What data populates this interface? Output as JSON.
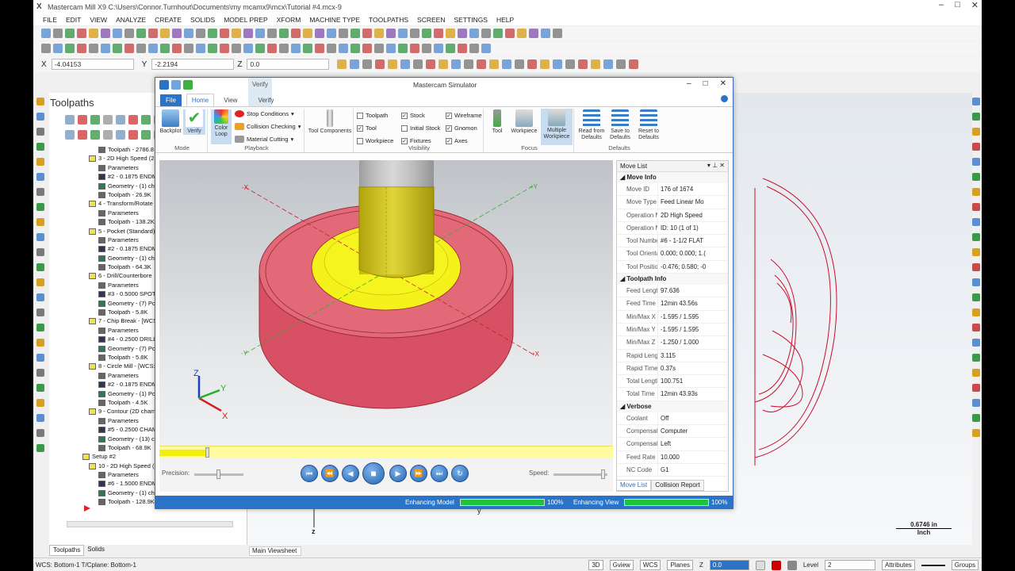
{
  "app": {
    "title": "Mastercam Mill X9  C:\\Users\\Connor.Turnhout\\Documents\\my mcamx9\\mcx\\Tutorial #4.mcx-9"
  },
  "menu": [
    "FILE",
    "EDIT",
    "VIEW",
    "ANALYZE",
    "CREATE",
    "SOLIDS",
    "MODEL PREP",
    "XFORM",
    "MACHINE TYPE",
    "TOOLPATHS",
    "SCREEN",
    "SETTINGS",
    "HELP"
  ],
  "coords": {
    "x_label": "X",
    "x": "-4.04153",
    "y_label": "Y",
    "y": "-2.2194",
    "z_label": "Z",
    "z": "0.0"
  },
  "toolpaths_panel": {
    "title": "Toolpaths",
    "tree": [
      "Toolpath - 2786.8",
      "3 - 2D High Speed (2D",
      "Parameters",
      "#2 - 0.1875 ENDM",
      "Geometry - (1) cha",
      "Toolpath - 26.9K",
      "4 - Transform/Rotate",
      "Parameters",
      "Toolpath - 138.2K",
      "5 - Pocket (Standard)",
      "Parameters",
      "#2 - 0.1875 ENDM",
      "Geometry - (1) ch",
      "Toolpath - 64.3K",
      "6 - Drill/Counterbore",
      "Parameters",
      "#3 - 0.5000 SPOT",
      "Geometry - (7) Poi",
      "Toolpath - 5.8K",
      "7 - Chip Break - [WCS:",
      "Parameters",
      "#4 - 0.2500 DRILL",
      "Geometry - (7) Poi",
      "Toolpath - 5.8K",
      "8 - Circle Mill - [WCS:",
      "Parameters",
      "#2 - 0.1875 ENDM",
      "Geometry - (1) Poi",
      "Toolpath - 4.5K",
      "9 - Contour (2D cham",
      "Parameters",
      "#5 - 0.2500 CHAM",
      "Geometry - (13) c",
      "Toolpath - 68.9K",
      "Setup #2",
      "10 - 2D High Speed (2",
      "Parameters",
      "#6 - 1.5000 ENDM",
      "Geometry - (1) ch",
      "Toolpath - 128.9K"
    ],
    "bottom_tabs": [
      "Toolpaths",
      "Solids"
    ]
  },
  "viewsheet": "Main Viewsheet",
  "status": {
    "left": "WCS: Bottom-1  T/Cplane: Bottom-1",
    "items": [
      "3D",
      "Gview",
      "WCS",
      "Planes",
      "Z",
      "0.0",
      "Level",
      "2",
      "Attributes",
      "Groups"
    ]
  },
  "scale": {
    "value": "0.6746 in",
    "unit": "Inch"
  },
  "simulator": {
    "title": "Mastercam Simulator",
    "context_tab": "Verify",
    "tabs": [
      "File",
      "Home",
      "View",
      "Verify"
    ],
    "ribbon": {
      "mode": {
        "label": "Mode",
        "buttons": [
          "Backplot",
          "Verify"
        ]
      },
      "playback": {
        "label": "Playback",
        "color_loop": "Color Loop",
        "items": [
          "Stop Conditions",
          "Collision Checking",
          "Material Cutting"
        ]
      },
      "tool_components": "Tool Components",
      "visibility": {
        "label": "Visibility",
        "checks": [
          {
            "label": "Toolpath",
            "on": false
          },
          {
            "label": "Stock",
            "on": true
          },
          {
            "label": "Wireframe",
            "on": true
          },
          {
            "label": "Tool",
            "on": true
          },
          {
            "label": "Initial Stock",
            "on": false
          },
          {
            "label": "Gnomon",
            "on": true
          },
          {
            "label": "Workpiece",
            "on": false
          },
          {
            "label": "Fixtures",
            "on": true
          },
          {
            "label": "Axes",
            "on": true
          }
        ]
      },
      "focus": {
        "label": "Focus",
        "buttons": [
          "Tool",
          "Workpiece",
          "Multiple Workpiece"
        ]
      },
      "defaults": {
        "label": "Defaults",
        "buttons": [
          "Read from Defaults",
          "Save to Defaults",
          "Reset to Defaults"
        ]
      }
    },
    "controls": {
      "precision": "Precision:",
      "speed": "Speed:",
      "playback_position": 0.1
    },
    "movelist": {
      "title": "Move List",
      "move_info_label": "Move Info",
      "move_info": [
        {
          "k": "Move ID",
          "v": "176 of 1674"
        },
        {
          "k": "Move Type",
          "v": "Feed Linear Mo"
        },
        {
          "k": "Operation N",
          "v": "2D High Speed"
        },
        {
          "k": "Operation N",
          "v": "ID: 10 (1 of 1)"
        },
        {
          "k": "Tool Numbe",
          "v": "#6 - 1-1/2 FLAT"
        },
        {
          "k": "Tool Orienta",
          "v": "0.000; 0.000; 1.("
        },
        {
          "k": "Tool Position",
          "v": "-0.476; 0.580; -0"
        }
      ],
      "toolpath_info_label": "Toolpath Info",
      "toolpath_info": [
        {
          "k": "Feed Length",
          "v": "97.636"
        },
        {
          "k": "Feed Time",
          "v": "12min 43.56s"
        },
        {
          "k": "Min/Max X",
          "v": "-1.595 / 1.595"
        },
        {
          "k": "Min/Max Y",
          "v": "-1.595 / 1.595"
        },
        {
          "k": "Min/Max Z",
          "v": "-1.250 / 1.000"
        },
        {
          "k": "Rapid Length",
          "v": "3.115"
        },
        {
          "k": "Rapid Time",
          "v": "0.37s"
        },
        {
          "k": "Total Length",
          "v": "100.751"
        },
        {
          "k": "Total Time",
          "v": "12min 43.93s"
        }
      ],
      "verbose_label": "Verbose",
      "verbose": [
        {
          "k": "Coolant",
          "v": "Off"
        },
        {
          "k": "Compensati",
          "v": "Computer"
        },
        {
          "k": "Compensati",
          "v": "Left"
        },
        {
          "k": "Feed Rate",
          "v": "10.000"
        },
        {
          "k": "NC Code",
          "v": "G1"
        }
      ],
      "tabs": [
        "Move List",
        "Collision Report"
      ]
    },
    "statusbar": {
      "enhancing_model": "Enhancing Model",
      "model_pct": "100%",
      "model_progress": 1.0,
      "enhancing_view": "Enhancing View",
      "view_pct": "100%",
      "view_progress": 1.0
    },
    "axis_labels": {
      "x": "X",
      "y": "Y",
      "z": "Z"
    }
  },
  "colors": {
    "accent": "#2b73c6",
    "stock": "#e05a6a",
    "cut": "#f4f21a",
    "tool": "#c9bd1e",
    "progress": "#1fc43a"
  }
}
